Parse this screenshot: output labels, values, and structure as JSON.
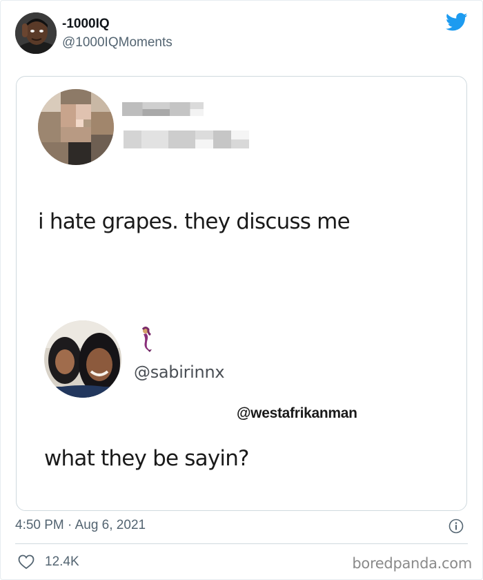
{
  "tweet": {
    "display_name": "-1000IQ",
    "handle": "@1000IQMoments",
    "timestamp": "4:50 PM · Aug 6, 2021",
    "likes": "12.4K"
  },
  "icons": {
    "brand": "twitter-bird-icon",
    "info": "info-icon",
    "like": "heart-icon"
  },
  "colors": {
    "brand_blue": "#1d9bf0",
    "secondary_text": "#536471",
    "border": "#cfd9de"
  },
  "media": {
    "original_post": "i hate grapes. they discuss me",
    "reply_handle": "@sabirinnx",
    "reply_mention": "@westafrikanman",
    "reply_text": "what they be sayin?"
  },
  "watermark": "boredpanda.com"
}
